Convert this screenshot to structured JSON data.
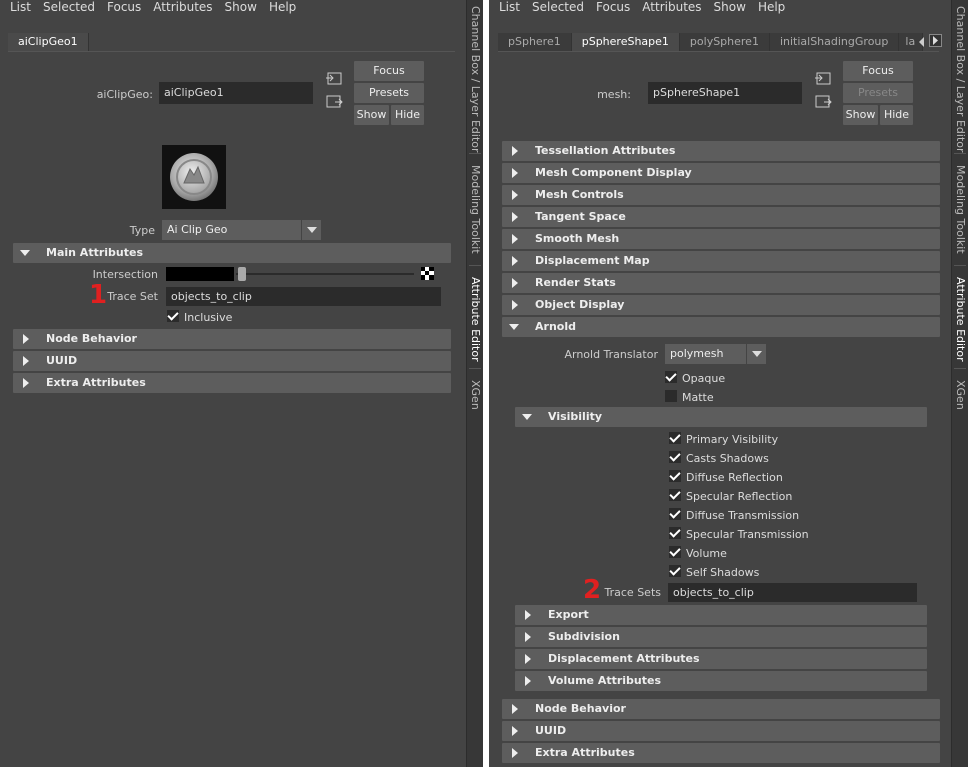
{
  "left": {
    "menu": [
      "List",
      "Selected",
      "Focus",
      "Attributes",
      "Show",
      "Help"
    ],
    "tabs": [
      "aiClipGeo1"
    ],
    "node_label": "aiClipGeo:",
    "node_value": "aiClipGeo1",
    "buttons": {
      "focus": "Focus",
      "presets": "Presets",
      "show": "Show",
      "hide": "Hide"
    },
    "type_label": "Type",
    "type_value": "Ai Clip Geo",
    "main_section": "Main Attributes",
    "intersection_label": "Intersection",
    "trace_set_label": "Trace Set",
    "trace_set_value": "objects_to_clip",
    "inclusive_label": "Inclusive",
    "marker": "1",
    "sections": [
      "Node Behavior",
      "UUID",
      "Extra Attributes"
    ]
  },
  "right": {
    "menu": [
      "List",
      "Selected",
      "Focus",
      "Attributes",
      "Show",
      "Help"
    ],
    "tabs": [
      "pSphere1",
      "pSphereShape1",
      "polySphere1",
      "initialShadingGroup",
      "la"
    ],
    "node_label": "mesh:",
    "node_value": "pSphereShape1",
    "buttons": {
      "focus": "Focus",
      "presets": "Presets",
      "show": "Show",
      "hide": "Hide"
    },
    "sections": [
      "Tessellation Attributes",
      "Mesh Component Display",
      "Mesh Controls",
      "Tangent Space",
      "Smooth Mesh",
      "Displacement Map",
      "Render Stats",
      "Object Display"
    ],
    "arnold_section": "Arnold",
    "translator_label": "Arnold Translator",
    "translator_value": "polymesh",
    "opaque_label": "Opaque",
    "matte_label": "Matte",
    "visibility_section": "Visibility",
    "visibility_items": [
      "Primary Visibility",
      "Casts Shadows",
      "Diffuse Reflection",
      "Specular Reflection",
      "Diffuse Transmission",
      "Specular Transmission",
      "Volume",
      "Self Shadows"
    ],
    "trace_sets_label": "Trace Sets",
    "trace_sets_value": "objects_to_clip",
    "marker": "2",
    "sub_sections": [
      "Export",
      "Subdivision",
      "Displacement Attributes",
      "Volume Attributes"
    ],
    "bottom_sections": [
      "Node Behavior",
      "UUID",
      "Extra Attributes"
    ]
  },
  "side_tabs": [
    "Channel Box / Layer Editor",
    "Modeling Toolkit",
    "Attribute Editor",
    "XGen"
  ],
  "colors": {
    "marker": "#e02020",
    "section_bg": "#5d5d5d",
    "panel_bg": "#444444",
    "field_bg": "#2b2b2b"
  }
}
